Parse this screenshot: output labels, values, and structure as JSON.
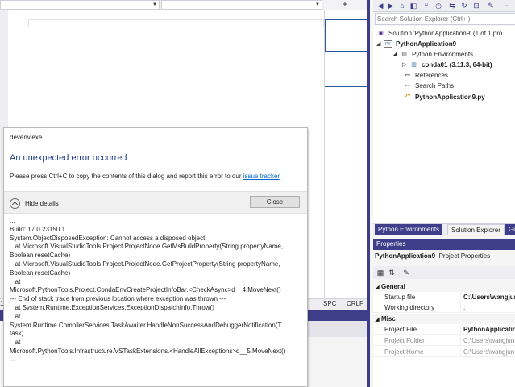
{
  "editor": {
    "status": {
      "ln": "1",
      "spc": "SPC",
      "crlf": "CRLF"
    }
  },
  "dialog": {
    "title": "devenv.exe",
    "heading": "An unexpected error occurred",
    "message": "Please press Ctrl+C to copy the contents of this dialog and report this error to our ",
    "link_text": "issue tracker",
    "message_end": ".",
    "hide_details_label": "Hide details",
    "close_label": "Close",
    "details_lines": [
      "...",
      "",
      "Build: 17.0.23150.1",
      "",
      "System.ObjectDisposedException: Cannot access a disposed object.",
      "   at Microsoft.VisualStudioTools.Project.ProjectNode.GetMsBuildProperty(String propertyName,",
      "Boolean resetCache)",
      "   at Microsoft.VisualStudioTools.Project.ProjectNode.GetProjectProperty(String propertyName,",
      "Boolean resetCache)",
      "   at",
      "Microsoft.PythonTools.Project.CondaEnvCreateProjectInfoBar.<CheckAsync>d__4.MoveNext()",
      "--- End of stack trace from previous location where exception was thrown ---",
      "   at System.Runtime.ExceptionServices.ExceptionDispatchInfo.Throw()",
      "   at",
      "System.Runtime.CompilerServices.TaskAwaiter.HandleNonSuccessAndDebuggerNotification(T...",
      "task)",
      "   at",
      "Microsoft.PythonTools.Infrastructure.VSTaskExtensions.<HandleAllExceptions>d__5.MoveNext()",
      "---"
    ]
  },
  "solution_explorer": {
    "search_placeholder": "Search Solution Explorer (Ctrl+;)",
    "items": [
      {
        "label": "Solution 'PythonApplication9' (1 of 1 pro"
      },
      {
        "label": "PythonApplication9"
      },
      {
        "label": "Python Environments"
      },
      {
        "label": "conda01 (3.11.3, 64-bit)"
      },
      {
        "label": "References"
      },
      {
        "label": "Search Paths"
      },
      {
        "label": "PythonApplication9.py"
      }
    ],
    "tabs": [
      "Python Environments",
      "Solution Explorer",
      "Git"
    ]
  },
  "properties": {
    "title": "Properties",
    "object_name": "PythonApplication9",
    "object_type": "Project Properties",
    "categories": [
      {
        "name": "General",
        "rows": [
          {
            "name": "Startup file",
            "value": "C:\\Users\\wangjun",
            "bold": true
          },
          {
            "name": "Working directory",
            "value": "."
          }
        ]
      },
      {
        "name": "Misc",
        "rows": [
          {
            "name": "Project File",
            "value": "PythonApplication",
            "bold": true
          },
          {
            "name": "Project Folder",
            "value": "C:\\Users\\wangjun",
            "gray": true
          },
          {
            "name": "Project Home",
            "value": "C:\\Users\\wangjun",
            "gray": true
          }
        ]
      }
    ]
  },
  "colors": {
    "accent": "#3e3e8a",
    "link": "#0066cc",
    "heading": "#1f3b8c"
  }
}
